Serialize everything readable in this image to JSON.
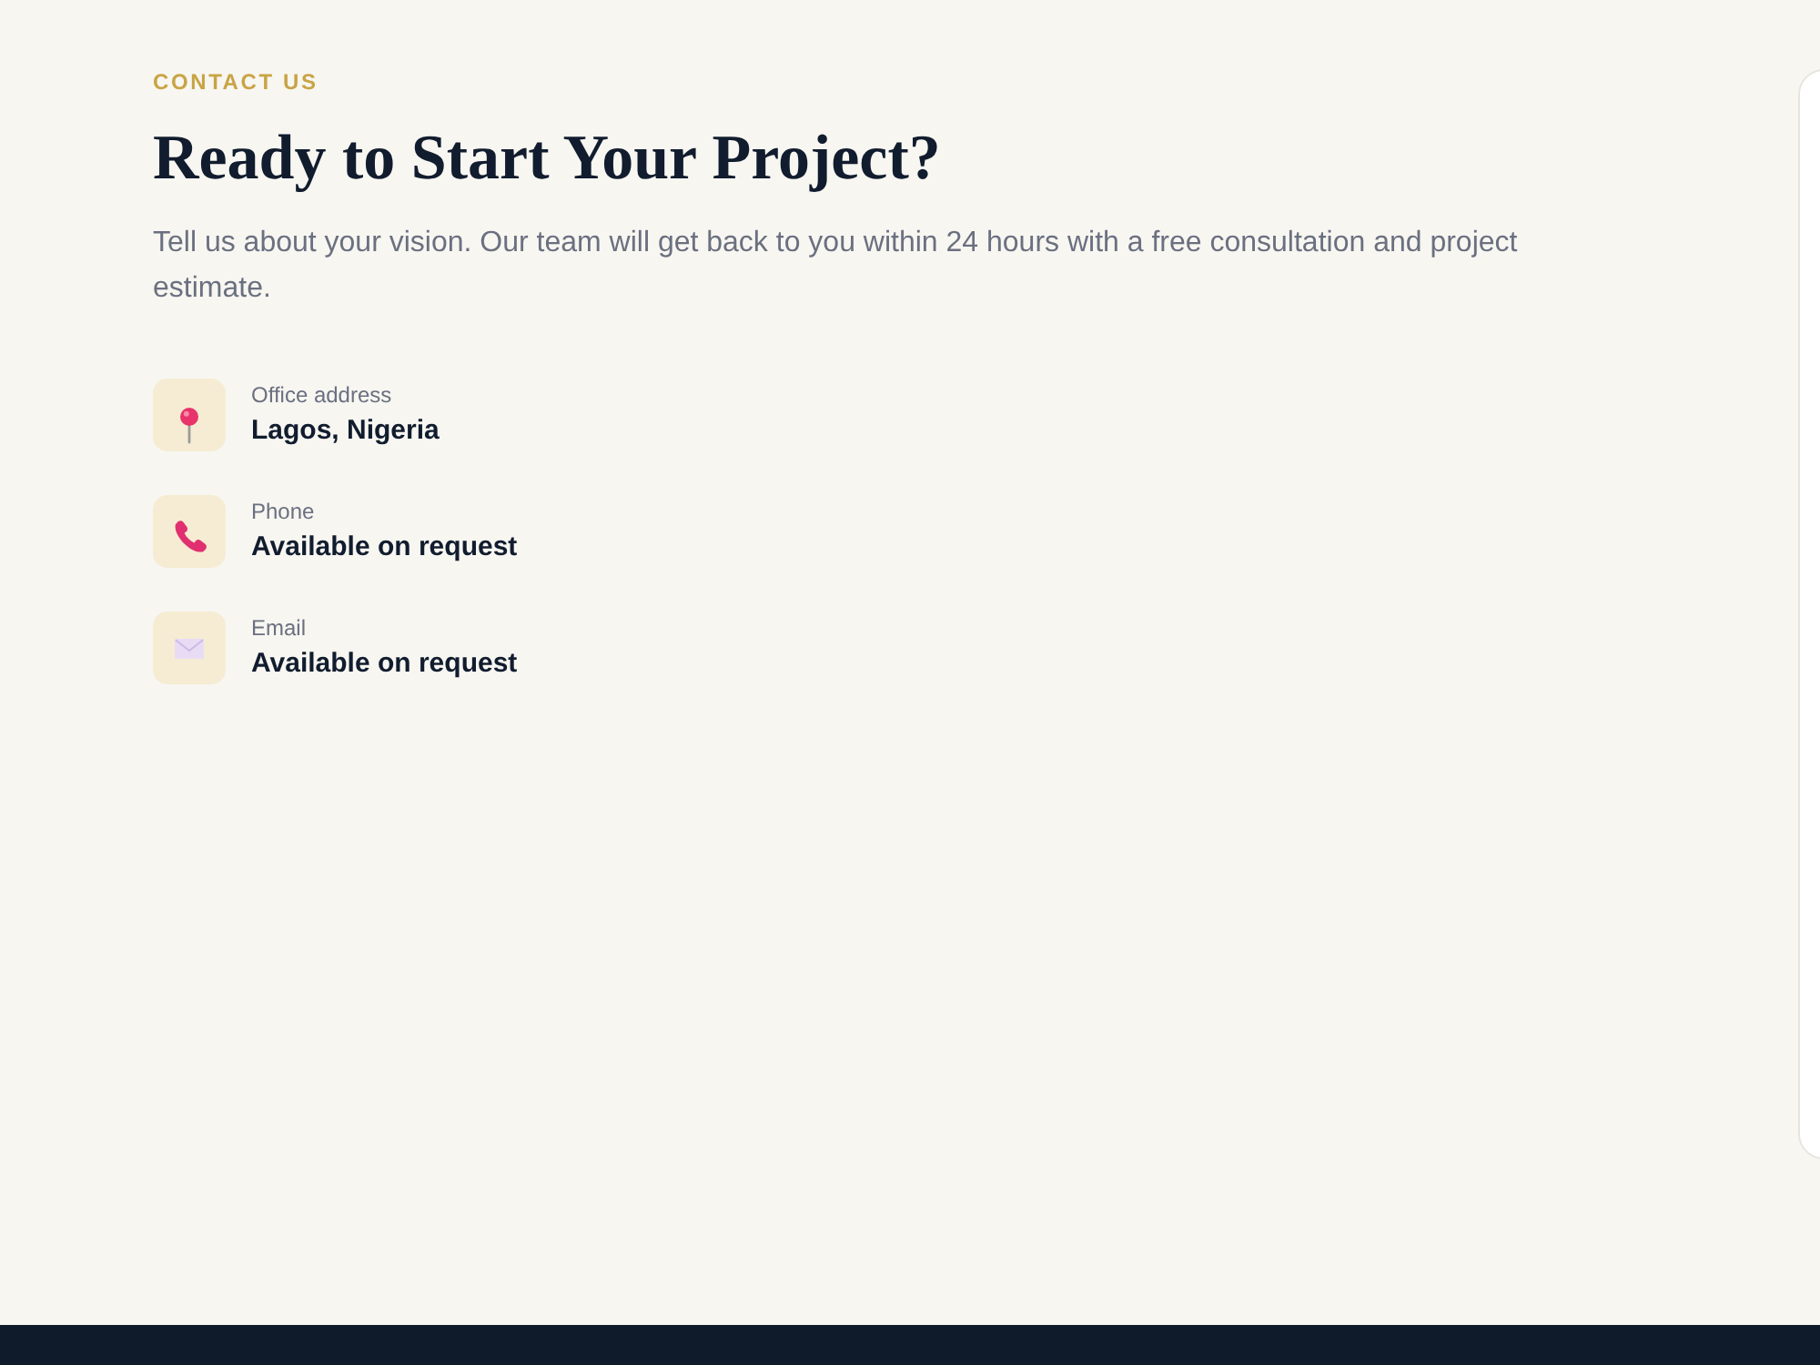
{
  "eyebrow": "CONTACT US",
  "heading": "Ready to Start Your Project?",
  "intro": "Tell us about your vision. Our team will get back to you within 24 hours with a free consultation and project estimate.",
  "contacts": [
    {
      "kind": "location",
      "label": "Office address",
      "value": "Lagos, Nigeria"
    },
    {
      "kind": "phone",
      "label": "Phone",
      "value": "Available on request"
    },
    {
      "kind": "email",
      "label": "Email",
      "value": "Available on request"
    }
  ]
}
